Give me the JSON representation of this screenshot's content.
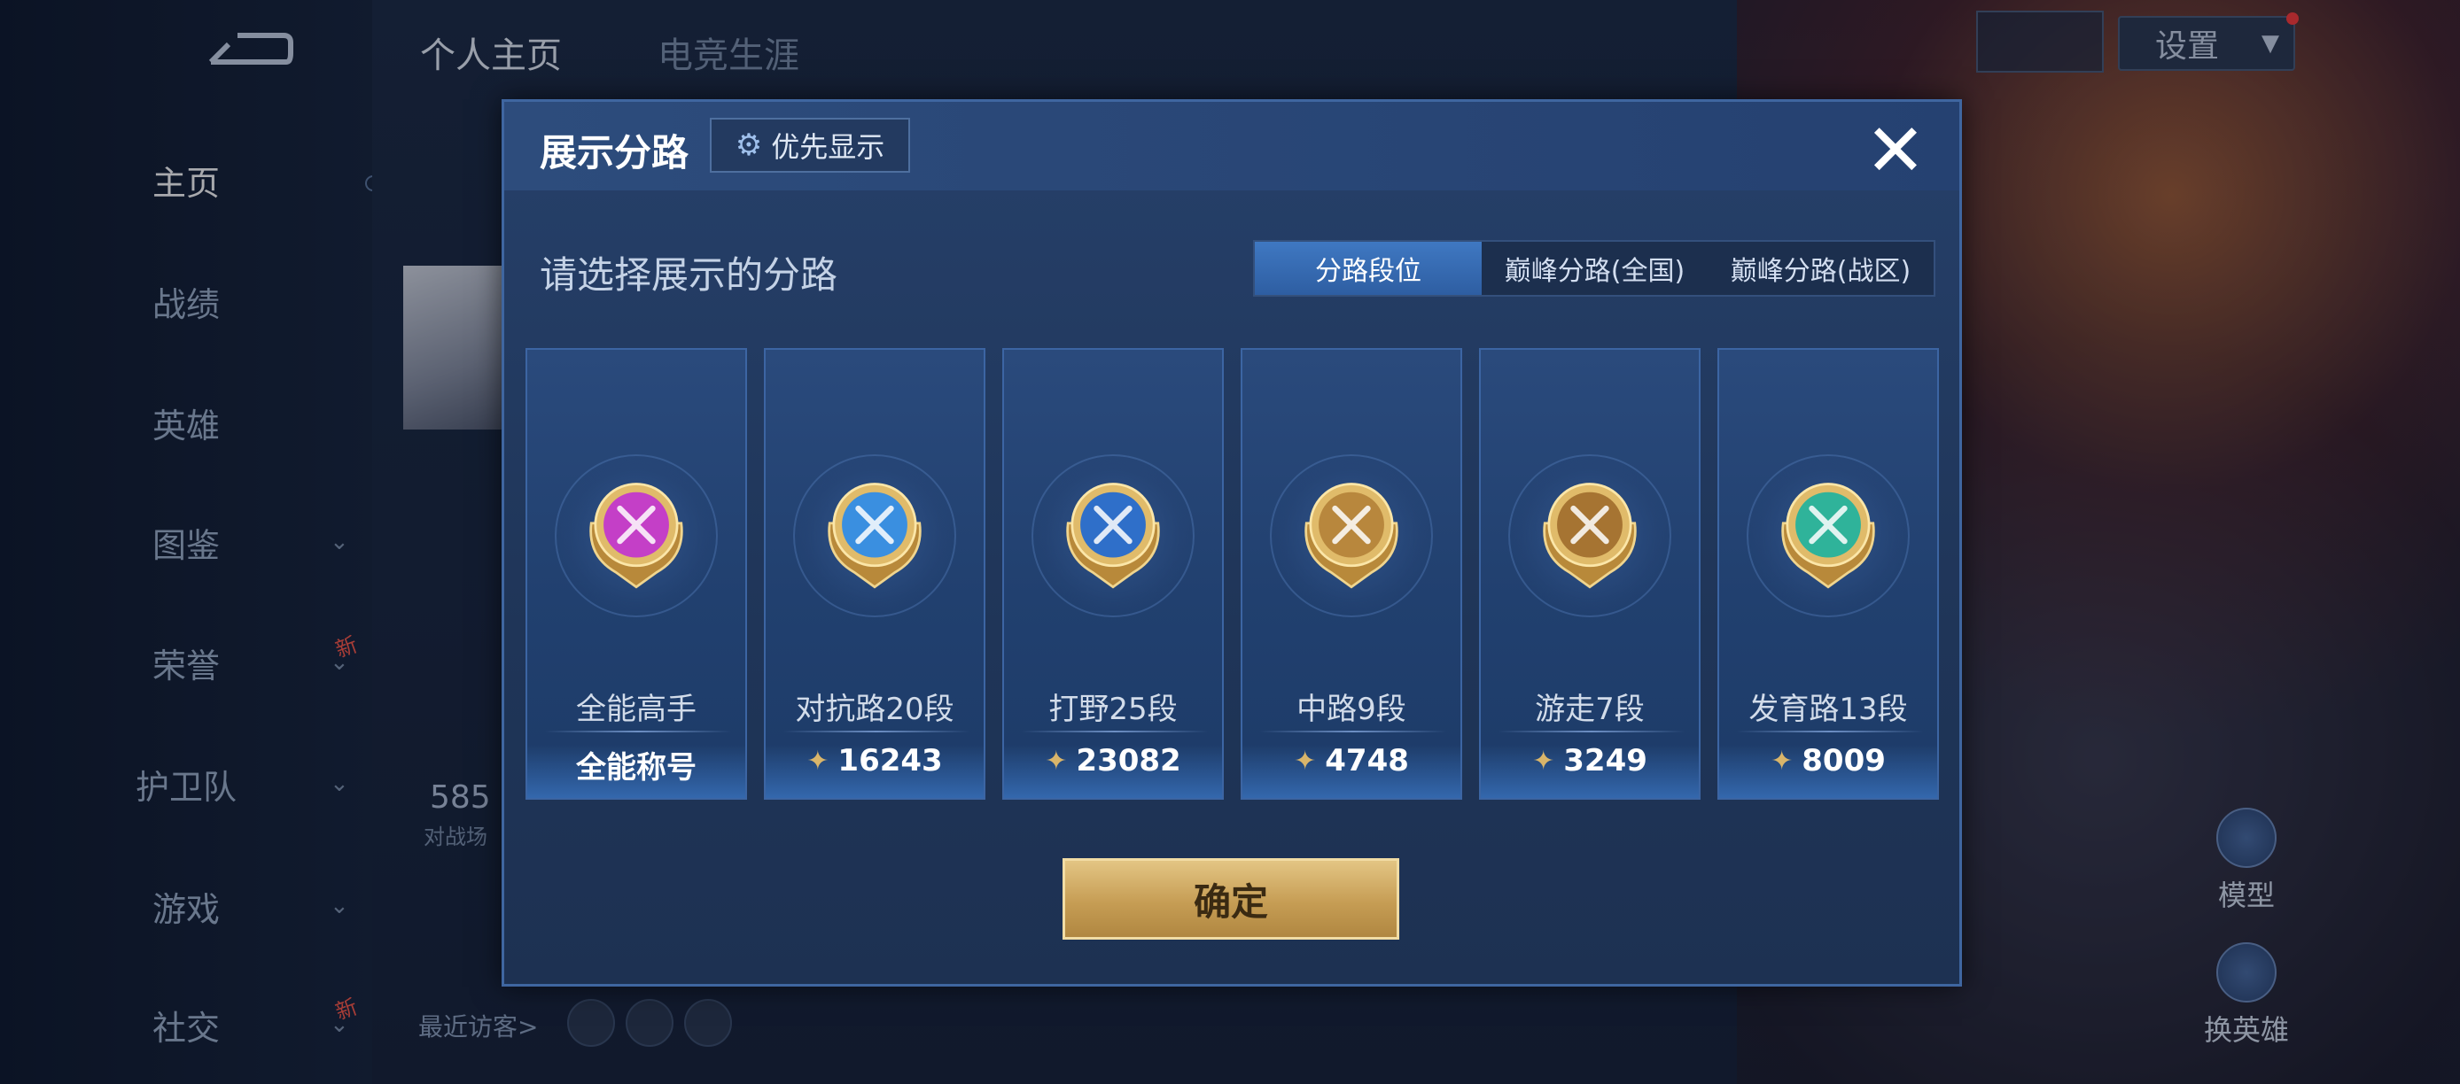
{
  "sidebar": {
    "items": [
      {
        "label": "主页",
        "active": true,
        "chevron": false,
        "new": false
      },
      {
        "label": "战绩",
        "active": false,
        "chevron": false,
        "new": false
      },
      {
        "label": "英雄",
        "active": false,
        "chevron": false,
        "new": false
      },
      {
        "label": "图鉴",
        "active": false,
        "chevron": true,
        "new": false
      },
      {
        "label": "荣誉",
        "active": false,
        "chevron": true,
        "new": true
      },
      {
        "label": "护卫队",
        "active": false,
        "chevron": true,
        "new": false
      },
      {
        "label": "游戏",
        "active": false,
        "chevron": true,
        "new": false
      },
      {
        "label": "社交",
        "active": false,
        "chevron": true,
        "new": true
      }
    ],
    "new_badge": "新"
  },
  "background": {
    "tabs": [
      "个人主页",
      "电竞生涯"
    ],
    "score": "585",
    "score_sub": "对战场",
    "visitors_label": "最近访客>"
  },
  "top_right": {
    "settings_label": "设置",
    "model_label": "模型",
    "switch_hero_label": "换英雄"
  },
  "modal": {
    "title": "展示分路",
    "priority_label": "优先显示",
    "subtitle": "请选择展示的分路",
    "tabs": [
      {
        "label": "分路段位",
        "active": true
      },
      {
        "label": "巅峰分路(全国)",
        "active": false
      },
      {
        "label": "巅峰分路(战区)",
        "active": false
      }
    ],
    "cards": [
      {
        "name": "全能高手",
        "value": "全能称号",
        "show_points_icon": false,
        "badge_color": "#c43fc7",
        "badge_icon": "allround-badge-icon"
      },
      {
        "name": "对抗路20段",
        "value": "16243",
        "show_points_icon": true,
        "badge_color": "#3a8fe0",
        "badge_icon": "clash-lane-badge-icon"
      },
      {
        "name": "打野25段",
        "value": "23082",
        "show_points_icon": true,
        "badge_color": "#2f6fc9",
        "badge_icon": "jungle-badge-icon"
      },
      {
        "name": "中路9段",
        "value": "4748",
        "show_points_icon": true,
        "badge_color": "#b8873d",
        "badge_icon": "mid-lane-badge-icon"
      },
      {
        "name": "游走7段",
        "value": "3249",
        "show_points_icon": true,
        "badge_color": "#a67432",
        "badge_icon": "roam-badge-icon"
      },
      {
        "name": "发育路13段",
        "value": "8009",
        "show_points_icon": true,
        "badge_color": "#2fb39a",
        "badge_icon": "farm-lane-badge-icon"
      }
    ],
    "confirm_label": "确定",
    "accent_color": "#3f78c2",
    "gold_color": "#c69d54"
  }
}
